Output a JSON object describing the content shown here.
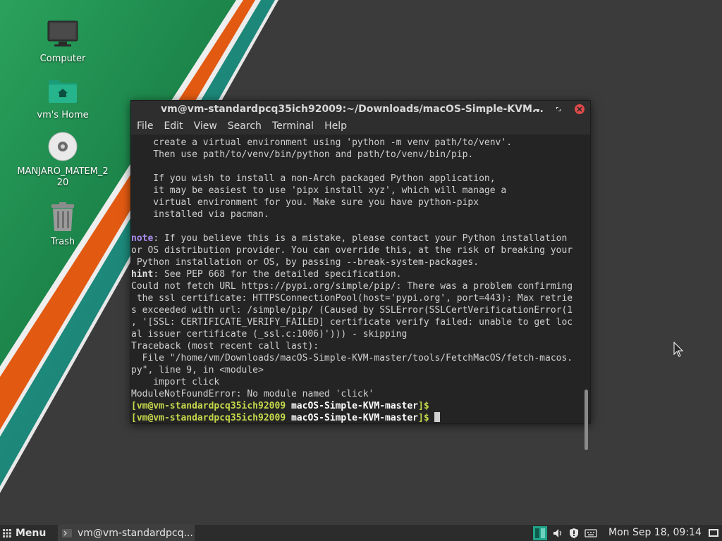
{
  "desktop": {
    "icons": [
      {
        "label": "Computer",
        "icon": "monitor-icon"
      },
      {
        "label": "vm's Home",
        "icon": "home-folder-icon"
      },
      {
        "label": "MANJARO_MATEM_220",
        "icon": "disc-icon"
      },
      {
        "label": "Trash",
        "icon": "trash-icon"
      }
    ],
    "colors": {
      "green": "#1f8a4c",
      "orange": "#e35a10",
      "teal": "#2a8f80",
      "background": "#3b3b3b"
    }
  },
  "window": {
    "title": "vm@vm-standardpcq35ich92009:~/Downloads/macOS-Simple-KVM...",
    "controls": {
      "minimize": "minimize-icon",
      "maximize": "maximize-icon",
      "close": "close-icon"
    },
    "menu": [
      "File",
      "Edit",
      "View",
      "Search",
      "Terminal",
      "Help"
    ]
  },
  "terminal": {
    "lines": [
      "    create a virtual environment using 'python -m venv path/to/venv'.",
      "    Then use path/to/venv/bin/python and path/to/venv/bin/pip.",
      "",
      "    If you wish to install a non-Arch packaged Python application,",
      "    it may be easiest to use 'pipx install xyz', which will manage a",
      "    virtual environment for you. Make sure you have python-pipx",
      "    installed via pacman.",
      ""
    ],
    "note_label": "note",
    "note_lines": [
      ": If you believe this is a mistake, please contact your Python installation",
      "or OS distribution provider. You can override this, at the risk of breaking your",
      " Python installation or OS, by passing --break-system-packages."
    ],
    "hint_label": "hint",
    "hint_text": ": See PEP 668 for the detailed specification.",
    "error_lines": [
      "Could not fetch URL https://pypi.org/simple/pip/: There was a problem confirming",
      " the ssl certificate: HTTPSConnectionPool(host='pypi.org', port=443): Max retrie",
      "s exceeded with url: /simple/pip/ (Caused by SSLError(SSLCertVerificationError(1",
      ", '[SSL: CERTIFICATE_VERIFY_FAILED] certificate verify failed: unable to get loc",
      "al issuer certificate (_ssl.c:1006)'))) - skipping",
      "Traceback (most recent call last):",
      "  File \"/home/vm/Downloads/macOS-Simple-KVM-master/tools/FetchMacOS/fetch-macos.",
      "py\", line 9, in <module>",
      "    import click",
      "ModuleNotFoundError: No module named 'click'"
    ],
    "prompts": [
      {
        "user": "[vm@vm-standardpcq35ich92009 ",
        "dir": "macOS-Simple-KVM-master",
        "end": "]$"
      },
      {
        "user": "[vm@vm-standardpcq35ich92009 ",
        "dir": "macOS-Simple-KVM-master",
        "end": "]$ "
      }
    ]
  },
  "taskbar": {
    "menu_label": "Menu",
    "task_label": "vm@vm-standardpcq...",
    "tray_icons": [
      "workspace-switcher-icon",
      "volume-icon",
      "shield-icon",
      "keyboard-icon"
    ],
    "clock": "Mon Sep 18, 09:14",
    "show_desktop_icon": "show-desktop-icon"
  }
}
